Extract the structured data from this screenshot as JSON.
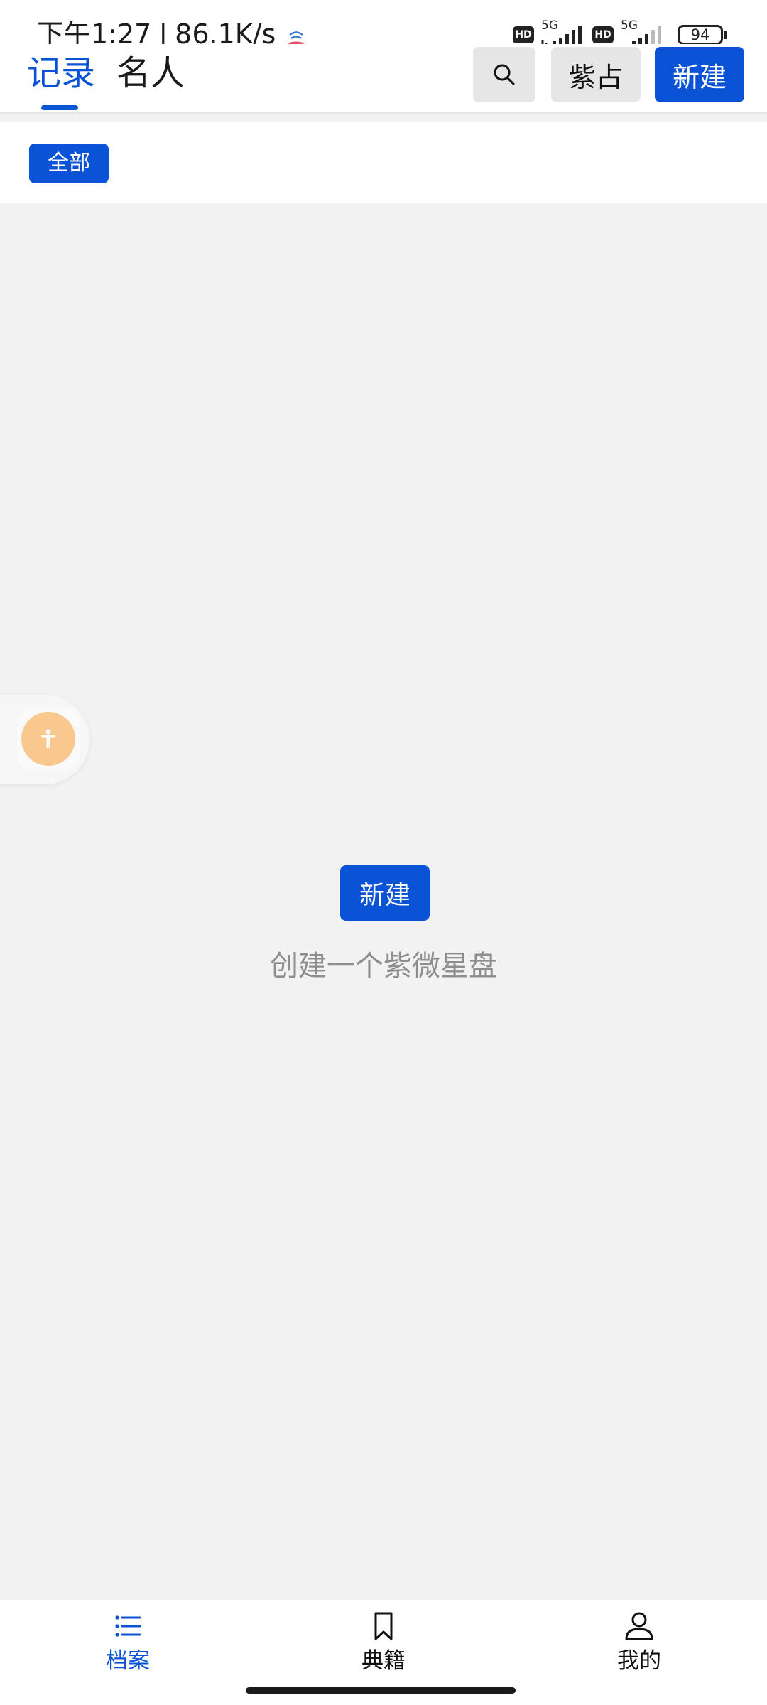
{
  "status_bar": {
    "time": "下午1:27",
    "separator": "|",
    "net_speed": "86.1K/s",
    "sim1_label": "HD",
    "sim1_network": "5G",
    "sim2_label": "HD",
    "sim2_network": "5G",
    "battery": "94"
  },
  "header": {
    "tabs": [
      {
        "label": "记录",
        "active": true
      },
      {
        "label": "名人",
        "active": false
      }
    ],
    "search_icon": "search-icon",
    "ziwei_label": "紫占",
    "new_label": "新建"
  },
  "filter": {
    "all_label": "全部"
  },
  "empty_state": {
    "new_label": "新建",
    "message": "创建一个紫微星盘"
  },
  "bottom_nav": {
    "items": [
      {
        "label": "档案",
        "icon": "list-icon",
        "active": true
      },
      {
        "label": "典籍",
        "icon": "bookmark-icon",
        "active": false
      },
      {
        "label": "我的",
        "icon": "person-icon",
        "active": false
      }
    ]
  },
  "colors": {
    "accent": "#0a52d6",
    "background": "#f2f2f2",
    "muted_text": "#8e8e8e",
    "float_button": "#f8c88f"
  }
}
